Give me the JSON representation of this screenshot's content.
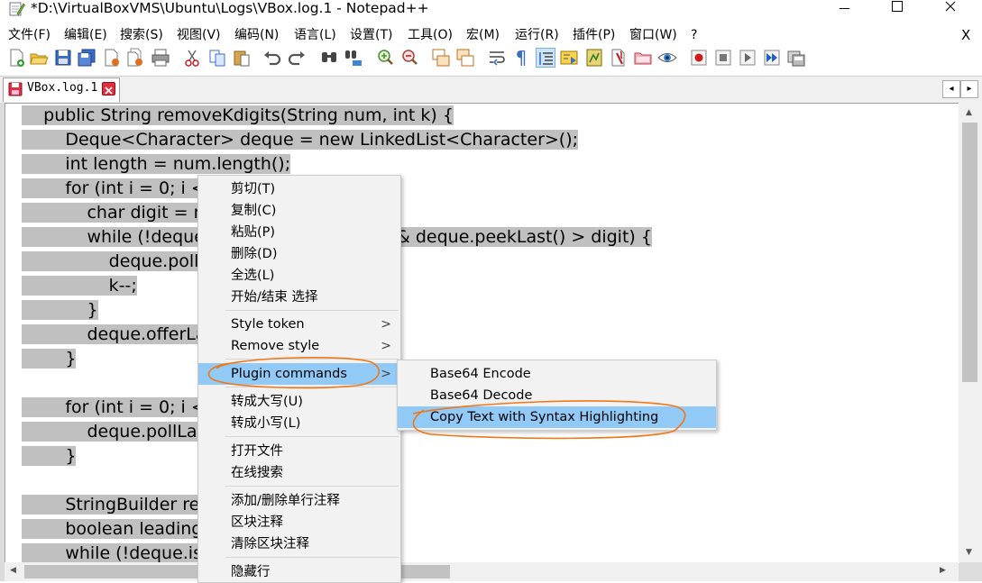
{
  "window": {
    "title": "*D:\\VirtualBoxVMS\\Ubuntu\\Logs\\VBox.log.1 - Notepad++",
    "minimize_icon": "minimize-icon",
    "maximize_icon": "maximize-icon",
    "close_icon": "close-icon"
  },
  "menubar": {
    "items": [
      {
        "label": "文件(F)"
      },
      {
        "label": "编辑(E)"
      },
      {
        "label": "搜索(S)"
      },
      {
        "label": "视图(V)"
      },
      {
        "label": "编码(N)"
      },
      {
        "label": "语言(L)"
      },
      {
        "label": "设置(T)"
      },
      {
        "label": "工具(O)"
      },
      {
        "label": "宏(M)"
      },
      {
        "label": "运行(R)"
      },
      {
        "label": "插件(P)"
      },
      {
        "label": "窗口(W)"
      },
      {
        "label": "?"
      }
    ],
    "close_label": "X"
  },
  "toolbar": {
    "icons": [
      "new-file-icon",
      "open-file-icon",
      "save-icon",
      "save-all-icon",
      "close-icon",
      "close-all-icon",
      "print-icon",
      "cut-icon",
      "copy-icon",
      "paste-icon",
      "undo-icon",
      "redo-icon",
      "find-icon",
      "replace-icon",
      "zoom-in-icon",
      "zoom-out-icon",
      "sync-vertical-icon",
      "sync-horizontal-icon",
      "word-wrap-icon",
      "show-all-chars-icon",
      "indent-guide-icon",
      "doc-map-icon",
      "function-list-icon",
      "folder-workspace-icon",
      "monitoring-icon",
      "eye-icon",
      "record-macro-icon",
      "stop-record-icon",
      "play-macro-icon",
      "run-macro-multiple-icon",
      "save-macro-icon"
    ]
  },
  "tabs": [
    {
      "label": "VBox.log.1",
      "icon": "unsaved-file-icon",
      "close_icon": "tab-close-icon"
    }
  ],
  "tab_nav": {
    "left": "◂",
    "right": "▸"
  },
  "editor": {
    "lines": [
      "    public String removeKdigits(String num, int k) {",
      "        Deque<Character> deque = new LinkedList<Character>();",
      "        int length = num.length();",
      "        for (int i = 0; i < ",
      "            char digit = n",
      "            while (!deque",
      "                deque.poll",
      "                k--;",
      "            }",
      "            deque.offerLa",
      "        }",
      "",
      "        for (int i = 0; i < ",
      "            deque.pollLa",
      "        }",
      "",
      "        StringBuilder re",
      "        boolean leading",
      "        while (!deque.is"
    ],
    "line5_tail": "& deque.peekLast() > digit) {"
  },
  "context_menu": {
    "items": [
      {
        "label": "剪切(T)"
      },
      {
        "label": "复制(C)"
      },
      {
        "label": "粘贴(P)"
      },
      {
        "label": "删除(D)"
      },
      {
        "label": "全选(L)"
      },
      {
        "label": "开始/结束 选择"
      },
      {
        "label": "Style token"
      },
      {
        "label": "Remove style"
      },
      {
        "label": "Plugin commands"
      },
      {
        "label": "转成大写(U)"
      },
      {
        "label": "转成小写(L)"
      },
      {
        "label": "打开文件"
      },
      {
        "label": "在线搜索"
      },
      {
        "label": "添加/删除单行注释"
      },
      {
        "label": "区块注释"
      },
      {
        "label": "清除区块注释"
      },
      {
        "label": "隐藏行"
      }
    ]
  },
  "submenu": {
    "items": [
      {
        "label": "Base64 Encode"
      },
      {
        "label": "Base64 Decode"
      },
      {
        "label": "Copy Text with Syntax Highlighting"
      }
    ]
  },
  "colors": {
    "selection": "#c0c0c0",
    "menu_highlight": "#91c9f7",
    "annotation": "#f07818"
  }
}
